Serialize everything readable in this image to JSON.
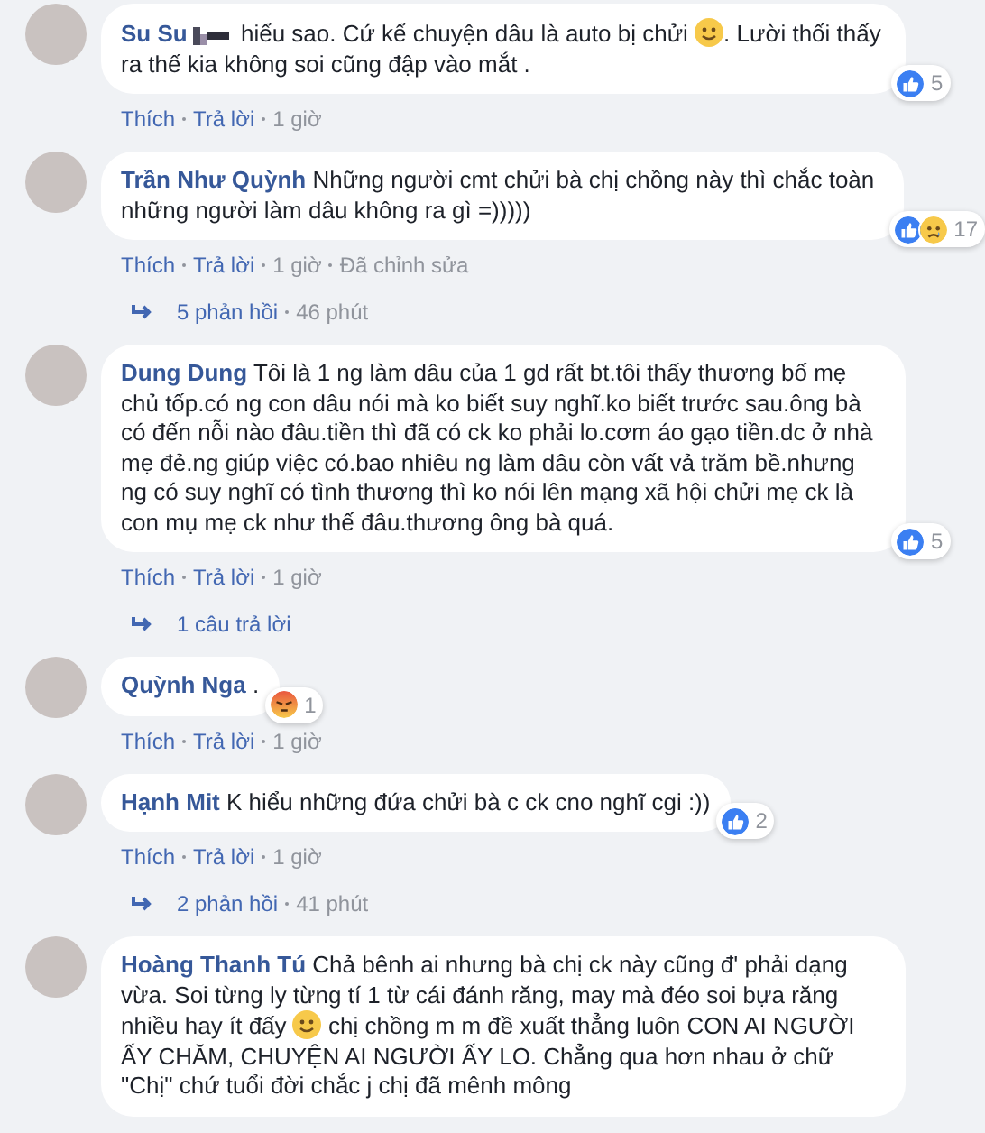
{
  "comments": [
    {
      "author": "Su Su",
      "redacted": true,
      "body": [
        {
          "kind": "text",
          "text": "hiểu sao. Cứ kể chuyện dâu là auto bị chửi "
        },
        {
          "kind": "emoji"
        },
        {
          "kind": "text",
          "text": ". Lười thối thấy ra thế kia không soi cũng đập vào mắt ."
        }
      ],
      "reactions": [
        {
          "kind": "like"
        }
      ],
      "reaction_count": "5",
      "actions": [
        "Thích",
        "Trả lời"
      ],
      "time": "1 giờ"
    },
    {
      "author": "Trần Như Quỳnh",
      "redacted": false,
      "body": [
        {
          "kind": "text",
          "text": "Những người cmt chửi bà chị chồng này thì chắc toàn những người làm dâu không ra gì =)))))"
        }
      ],
      "reactions": [
        {
          "kind": "like"
        },
        {
          "kind": "sad"
        }
      ],
      "reaction_count": "17",
      "actions": [
        "Thích",
        "Trả lời"
      ],
      "time": "1 giờ",
      "edited": "Đã chỉnh sửa",
      "replies": {
        "label": "5 phản hồi",
        "time": "46 phút"
      }
    },
    {
      "author": "Dung Dung",
      "redacted": false,
      "body": [
        {
          "kind": "text",
          "text": "Tôi là 1 ng làm dâu của 1 gd rất bt.tôi thấy thương bố mẹ chủ tốp.có ng con dâu nói mà ko biết suy nghĩ.ko biết trước sau.ông bà có đến nỗi nào đâu.tiền thì đã có ck ko phải lo.cơm áo gạo tiền.dc ở nhà mẹ đẻ.ng giúp việc có.bao nhiêu ng làm dâu còn vất vả trăm bề.nhưng ng có suy nghĩ có tình thương thì ko nói lên mạng xã hội chửi mẹ ck là con mụ mẹ ck như thế đâu.thương ông bà quá."
        }
      ],
      "reactions": [
        {
          "kind": "like"
        }
      ],
      "reaction_count": "5",
      "actions": [
        "Thích",
        "Trả lời"
      ],
      "time": "1 giờ",
      "replies": {
        "label": "1 câu trả lời"
      }
    },
    {
      "author": "Quỳnh Nga",
      "redacted": false,
      "body": [
        {
          "kind": "text",
          "text": "."
        }
      ],
      "reactions": [
        {
          "kind": "angry"
        }
      ],
      "reaction_count": "1",
      "actions": [
        "Thích",
        "Trả lời"
      ],
      "time": "1 giờ"
    },
    {
      "author": "Hạnh Mit",
      "redacted": false,
      "body": [
        {
          "kind": "text",
          "text": "K hiểu những đứa chửi bà c ck cno nghĩ cgi :))"
        }
      ],
      "reactions": [
        {
          "kind": "like"
        }
      ],
      "reaction_count": "2",
      "actions": [
        "Thích",
        "Trả lời"
      ],
      "time": "1 giờ",
      "replies": {
        "label": "2 phản hồi",
        "time": "41 phút"
      }
    },
    {
      "author": "Hoàng Thanh Tú",
      "redacted": false,
      "body": [
        {
          "kind": "text",
          "text": "Chả bênh ai nhưng bà chị ck này cũng đ' phải dạng vừa. Soi từng ly từng tí 1 từ cái đánh răng, may mà đéo soi bựa răng nhiều hay ít đấy "
        },
        {
          "kind": "emoji"
        },
        {
          "kind": "text",
          "text": " chị chồng m m đề xuất thẳng luôn CON AI NGƯỜI ẤY CHĂM, CHUYỆN AI NGƯỜI ẤY LO. Chẳng qua hơn nhau ở chữ \"Chị\" chứ tuổi đời chắc j chị đã mênh mông"
        }
      ]
    }
  ]
}
